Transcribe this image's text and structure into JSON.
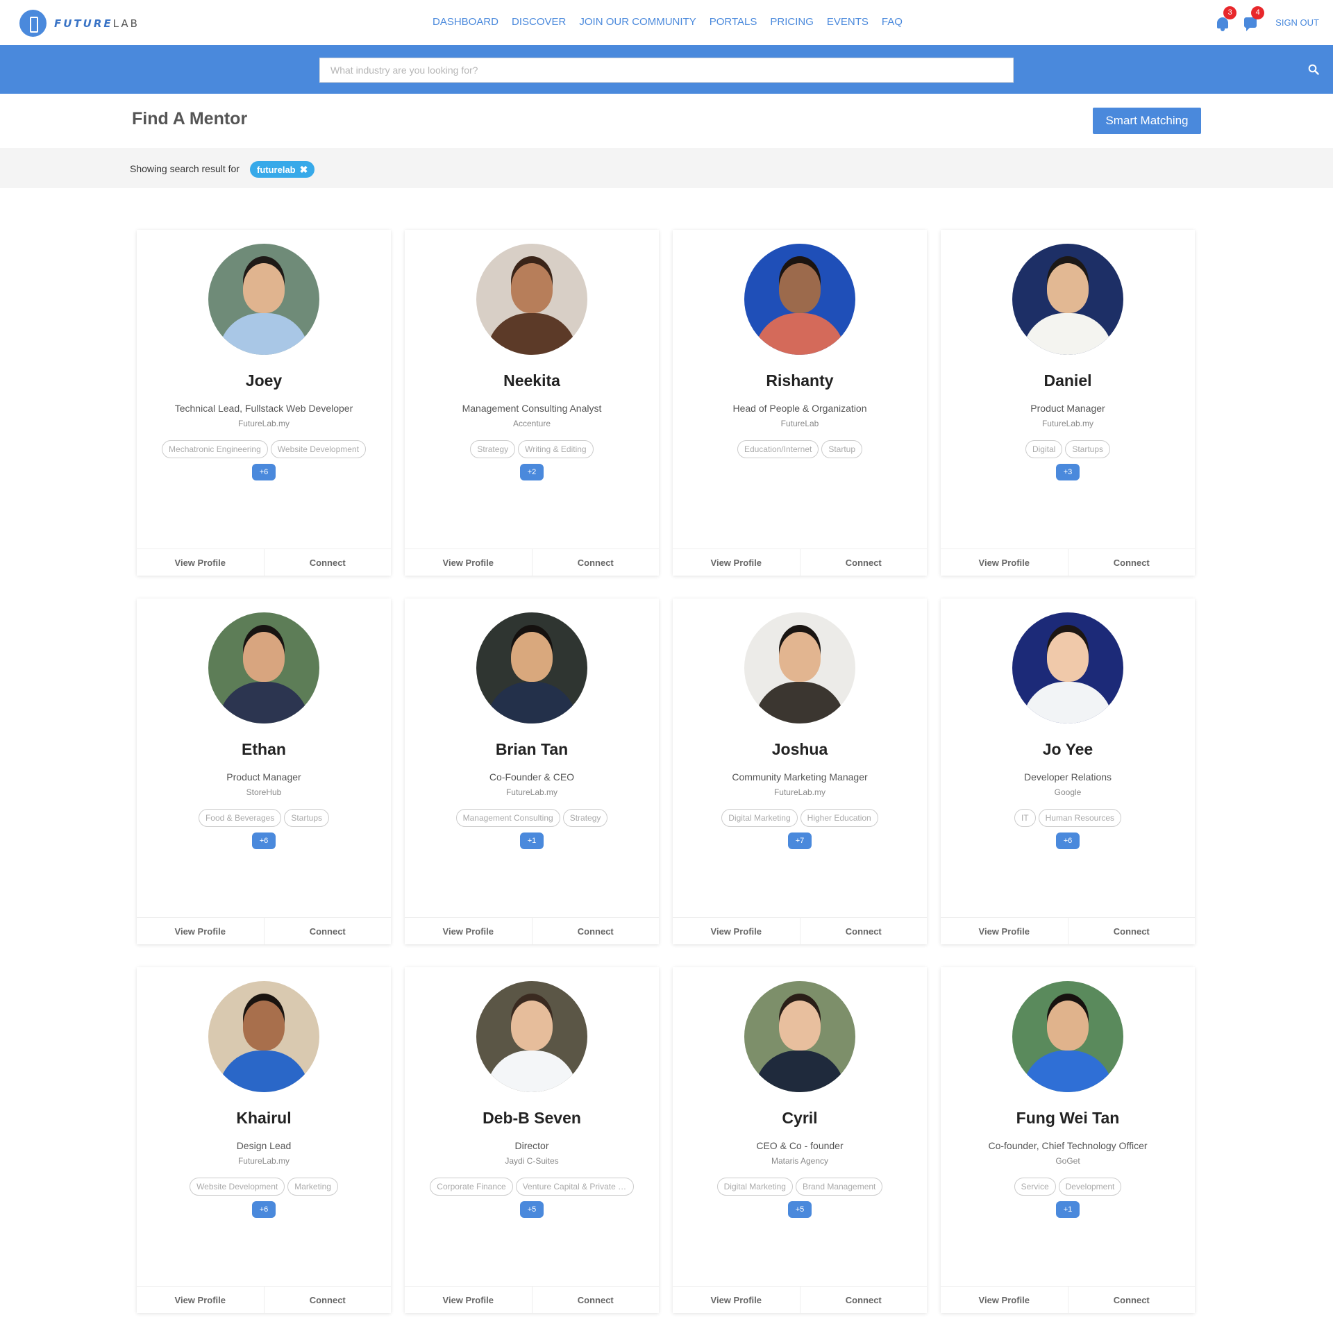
{
  "brand": {
    "name_bold": "FUTURE",
    "name_light": "LAB"
  },
  "nav": {
    "items": [
      "DASHBOARD",
      "DISCOVER",
      "JOIN OUR COMMUNITY",
      "PORTALS",
      "PRICING",
      "EVENTS",
      "FAQ"
    ],
    "notifications_count": "3",
    "messages_count": "4",
    "signout_label": "SIGN OUT"
  },
  "search": {
    "placeholder": "What industry are you looking for?"
  },
  "page": {
    "title": "Find A Mentor",
    "smart_matching_label": "Smart Matching",
    "filter_label": "Showing search result for",
    "filter_chip": "futurelab"
  },
  "card_actions": {
    "view_profile": "View Profile",
    "connect": "Connect"
  },
  "mentors": [
    {
      "name": "Joey",
      "role": "Technical Lead, Fullstack Web Developer",
      "company": "FutureLab.my",
      "tags": [
        "Mechatronic Engineering",
        "Website Development"
      ],
      "more": "+6",
      "skin": "#e0b48f",
      "hair": "#1f1a17",
      "shirt": "#a9c7e6",
      "bg": "#6f8b78"
    },
    {
      "name": "Neekita",
      "role": "Management Consulting Analyst",
      "company": "Accenture",
      "tags": [
        "Strategy",
        "Writing & Editing"
      ],
      "more": "+2",
      "skin": "#b77e5a",
      "hair": "#3a2418",
      "shirt": "#5c3a28",
      "bg": "#d8cfc6"
    },
    {
      "name": "Rishanty",
      "role": "Head of People & Organization",
      "company": "FutureLab",
      "tags": [
        "Education/Internet",
        "Startup"
      ],
      "more": "",
      "skin": "#9c6a4c",
      "hair": "#1b1410",
      "shirt": "#d46a5a",
      "bg": "#1f4fb8"
    },
    {
      "name": "Daniel",
      "role": "Product Manager",
      "company": "FutureLab.my",
      "tags": [
        "Digital",
        "Startups"
      ],
      "more": "+3",
      "skin": "#e2b893",
      "hair": "#1c1816",
      "shirt": "#f4f4f0",
      "bg": "#1d2f66"
    },
    {
      "name": "Ethan",
      "role": "Product Manager",
      "company": "StoreHub",
      "tags": [
        "Food & Beverages",
        "Startups"
      ],
      "more": "+6",
      "skin": "#d8a57f",
      "hair": "#181412",
      "shirt": "#2c3550",
      "bg": "#5d7d57"
    },
    {
      "name": "Brian Tan",
      "role": "Co-Founder & CEO",
      "company": "FutureLab.my",
      "tags": [
        "Management Consulting",
        "Strategy"
      ],
      "more": "+1",
      "skin": "#d9a87d",
      "hair": "#15110f",
      "shirt": "#23304a",
      "bg": "#2f3531"
    },
    {
      "name": "Joshua",
      "role": "Community Marketing Manager",
      "company": "FutureLab.my",
      "tags": [
        "Digital Marketing",
        "Higher Education"
      ],
      "more": "+7",
      "skin": "#e2b590",
      "hair": "#1a1512",
      "shirt": "#3b3630",
      "bg": "#ecebe8"
    },
    {
      "name": "Jo Yee",
      "role": "Developer Relations",
      "company": "Google",
      "tags": [
        "IT",
        "Human Resources"
      ],
      "more": "+6",
      "skin": "#f0c9aa",
      "hair": "#1c1613",
      "shirt": "#f2f4f6",
      "bg": "#1c2a78"
    },
    {
      "name": "Khairul",
      "role": "Design Lead",
      "company": "FutureLab.my",
      "tags": [
        "Website Development",
        "Marketing"
      ],
      "more": "+6",
      "skin": "#a86f4c",
      "hair": "#1a1410",
      "shirt": "#2a67c8",
      "bg": "#d9c9b0"
    },
    {
      "name": "Deb-B Seven",
      "role": "Director",
      "company": "Jaydi C-Suites",
      "tags": [
        "Corporate Finance",
        "Venture Capital & Private Equity"
      ],
      "more": "+5",
      "skin": "#e6bd9b",
      "hair": "#3a2a20",
      "shirt": "#f4f6f8",
      "bg": "#5b5646"
    },
    {
      "name": "Cyril",
      "role": "CEO & Co - founder",
      "company": "Mataris Agency",
      "tags": [
        "Digital Marketing",
        "Brand Management"
      ],
      "more": "+5",
      "skin": "#e8bf9e",
      "hair": "#2a1e17",
      "shirt": "#1f2a3c",
      "bg": "#7d8f6a"
    },
    {
      "name": "Fung Wei Tan",
      "role": "Co-founder, Chief Technology Officer",
      "company": "GoGet",
      "tags": [
        "Service",
        "Development"
      ],
      "more": "+1",
      "skin": "#e0b38c",
      "hair": "#17120f",
      "shirt": "#2f6fd6",
      "bg": "#5a8a5c"
    }
  ]
}
